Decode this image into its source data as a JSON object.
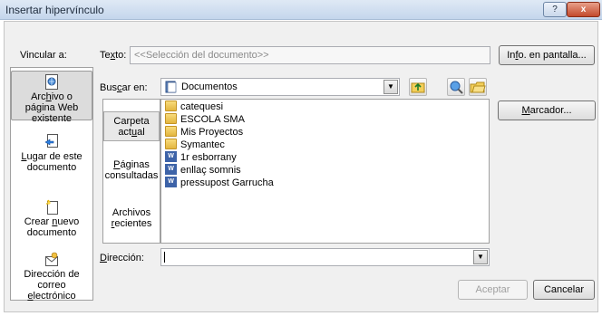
{
  "window": {
    "title": "Insertar hipervínculo",
    "help_glyph": "?",
    "close_glyph": "x"
  },
  "labels": {
    "link_to_prefix": "Vincular a:",
    "text_pre": "Te",
    "text_key": "x",
    "text_post": "to:",
    "lookin_pre": "Bus",
    "lookin_key": "c",
    "lookin_post": "ar en:",
    "address_pre": "",
    "address_key": "D",
    "address_post": "irección:"
  },
  "text_field": {
    "value": "<<Selección del documento>>"
  },
  "buttons": {
    "screen_tip_pre": "In",
    "screen_tip_key": "f",
    "screen_tip_post": "o. en pantalla...",
    "bookmark_pre": "",
    "bookmark_key": "M",
    "bookmark_post": "arcador...",
    "ok": "Aceptar",
    "cancel": "Cancelar"
  },
  "link_to": {
    "items": [
      {
        "line1_pre": "Arc",
        "line1_key": "h",
        "line1_post": "ivo o",
        "line2": "página Web",
        "line3": "existente",
        "icon": "web-page-icon"
      },
      {
        "line1_pre": "",
        "line1_key": "L",
        "line1_post": "ugar de este",
        "line2": "documento",
        "line3": "",
        "icon": "place-in-document-icon"
      },
      {
        "line1_pre": "Crear ",
        "line1_key": "n",
        "line1_post": "uevo",
        "line2": "documento",
        "line3": "",
        "icon": "new-document-icon"
      },
      {
        "line1_pre": "Dirección de",
        "line1_key": "",
        "line1_post": "",
        "line2": "correo",
        "line3_pre": "",
        "line3_key": "e",
        "line3_post": "lectrónico",
        "icon": "email-icon"
      }
    ]
  },
  "lookin": {
    "value": "Documentos",
    "icon": "documents-folder-icon"
  },
  "places": {
    "current": {
      "l1": "Carpeta",
      "l2_pre": "act",
      "l2_key": "u",
      "l2_post": "al"
    },
    "browsed": {
      "l1_pre": "",
      "l1_key": "P",
      "l1_post": "áginas",
      "l2": "consultadas"
    },
    "recent": {
      "l1": "Archivos",
      "l2_pre": "",
      "l2_key": "r",
      "l2_post": "ecientes"
    }
  },
  "files": [
    {
      "name": "catequesi",
      "type": "folder"
    },
    {
      "name": "ESCOLA SMA",
      "type": "folder"
    },
    {
      "name": "Mis Proyectos",
      "type": "folder"
    },
    {
      "name": "Symantec",
      "type": "folder"
    },
    {
      "name": "1r esborrany",
      "type": "doc"
    },
    {
      "name": "enllaç somnis",
      "type": "doc"
    },
    {
      "name": "pressupost Garrucha",
      "type": "doc"
    }
  ],
  "address": {
    "value": ""
  }
}
